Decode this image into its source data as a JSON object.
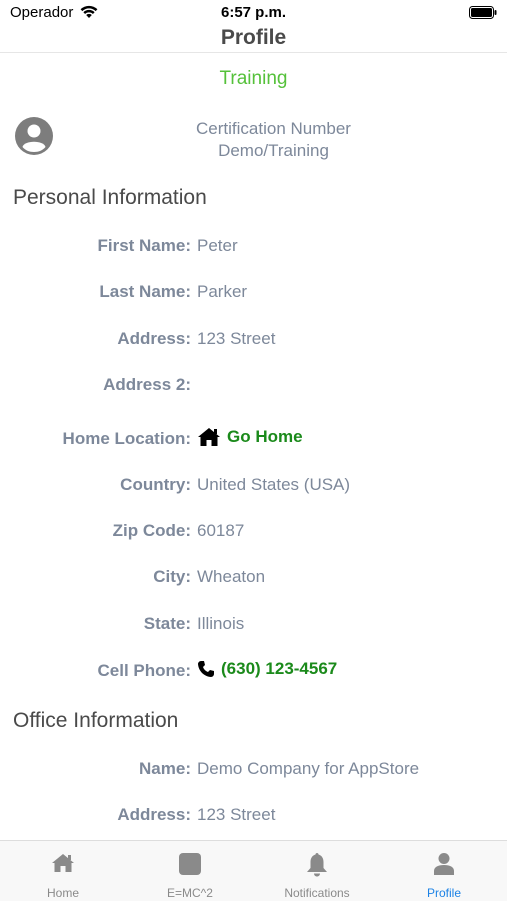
{
  "status_bar": {
    "carrier": "Operador",
    "time": "6:57 p.m."
  },
  "nav": {
    "title": "Profile"
  },
  "mode": "Training",
  "certification": {
    "label": "Certification Number",
    "value": "Demo/Training"
  },
  "personal": {
    "title": "Personal Information",
    "first_name": {
      "label": "First Name:",
      "value": "Peter"
    },
    "last_name": {
      "label": "Last Name:",
      "value": "Parker"
    },
    "address": {
      "label": "Address:",
      "value": "123 Street"
    },
    "address2": {
      "label": "Address 2:",
      "value": ""
    },
    "home_location": {
      "label": "Home Location:",
      "link": "Go Home"
    },
    "country": {
      "label": "Country:",
      "value": "United States (USA)"
    },
    "zip": {
      "label": "Zip Code:",
      "value": "60187"
    },
    "city": {
      "label": "City:",
      "value": "Wheaton"
    },
    "state": {
      "label": "State:",
      "value": "Illinois"
    },
    "cell": {
      "label": "Cell Phone:",
      "link": "(630) 123-4567"
    }
  },
  "office": {
    "title": "Office Information",
    "name": {
      "label": "Name:",
      "value": "Demo Company for AppStore"
    },
    "address": {
      "label": "Address:",
      "value": "123 Street"
    }
  },
  "tabs": [
    {
      "label": "Home",
      "icon": "home-icon"
    },
    {
      "label": "E=MC^2",
      "icon": "square-icon"
    },
    {
      "label": "Notifications",
      "icon": "bell-icon"
    },
    {
      "label": "Profile",
      "icon": "person-icon"
    }
  ],
  "colors": {
    "accent_green": "#55c13a",
    "link_green": "#1b8a1b",
    "tab_active": "#1c82e5",
    "text_gray": "#7d889a"
  }
}
